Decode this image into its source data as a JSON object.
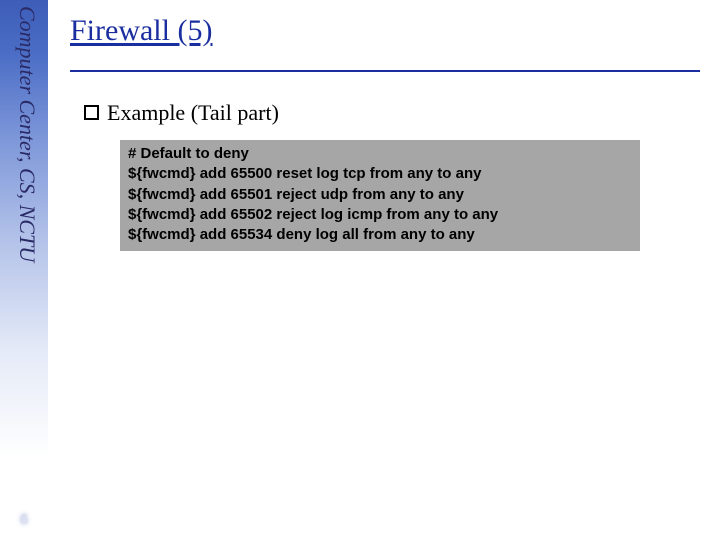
{
  "sidebar": {
    "label": "Computer Center, CS, NCTU"
  },
  "page_number": "6",
  "title": "Firewall (5)",
  "bullet": {
    "label": "Example (Tail part)"
  },
  "code": {
    "lines": [
      "# Default to deny",
      "${fwcmd} add 65500 reset log tcp from any to any",
      "${fwcmd} add 65501 reject udp from any to any",
      "${fwcmd} add 65502 reject log icmp from any to any",
      "${fwcmd} add 65534 deny log all from any to any"
    ]
  }
}
